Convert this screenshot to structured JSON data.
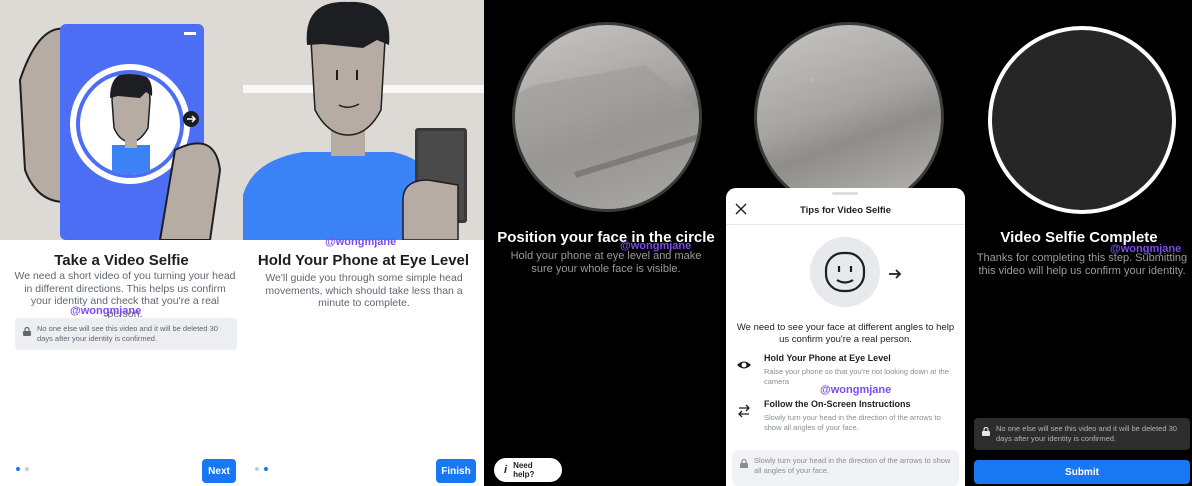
{
  "screen1": {
    "title": "Take a Video Selfie",
    "body": "We need a short video of you turning your head in different directions. This helps us confirm your identity and check that you're a real person.",
    "watermark": "@wongmjane",
    "privacy": "No one else will see this video and it will be deleted 30 days after your identity is confirmed.",
    "button": "Next",
    "icons": {
      "lock": "lock-icon",
      "arrow": "arrow-right-circle-icon"
    }
  },
  "screen2": {
    "title": "Hold Your Phone at Eye Level",
    "body": "We'll guide you through some simple head movements, which should take less than a minute to complete.",
    "watermark": "@wongmjane",
    "button": "Finish"
  },
  "screen3": {
    "title": "Position your face in the circle",
    "body": "Hold your phone at eye level and make sure your whole face is visible.",
    "watermark": "@wongmjane",
    "help": "Need help?",
    "icons": {
      "help": "info-icon"
    }
  },
  "screen4": {
    "sheet_title": "Tips for Video Selfie",
    "intro": "We need to see your face at different angles to help us confirm you're a real person.",
    "tips": [
      {
        "title": "Hold Your Phone at Eye Level",
        "desc": "Raise your phone so that you're not looking down at the camera",
        "icon": "eye-icon"
      },
      {
        "title": "Follow the On-Screen Instructions",
        "desc": "Slowly turn your head in the direction of the arrows to show all angles of your face.",
        "icon": "swap-arrows-icon"
      }
    ],
    "watermark": "@wongmjane",
    "footer": "Slowly turn your head in the direction of the arrows to show all angles of your face.",
    "icons": {
      "close": "close-icon",
      "face": "smiley-face-icon",
      "arrow": "arrow-right-icon"
    }
  },
  "screen5": {
    "title": "Video Selfie Complete",
    "body": "Thanks for completing this step. Submitting this video will help us confirm your identity.",
    "watermark": "@wongmjane",
    "privacy": "No one else will see this video and it will be deleted 30 days after your identity is confirmed.",
    "button": "Submit"
  },
  "colors": {
    "accent": "#1877f2",
    "watermark": "#7a4cf0",
    "illustration_bg": "#dddad6",
    "phone_blue": "#4c6ef5",
    "shirt_blue": "#3b82f6",
    "skin": "#b6aca3"
  }
}
